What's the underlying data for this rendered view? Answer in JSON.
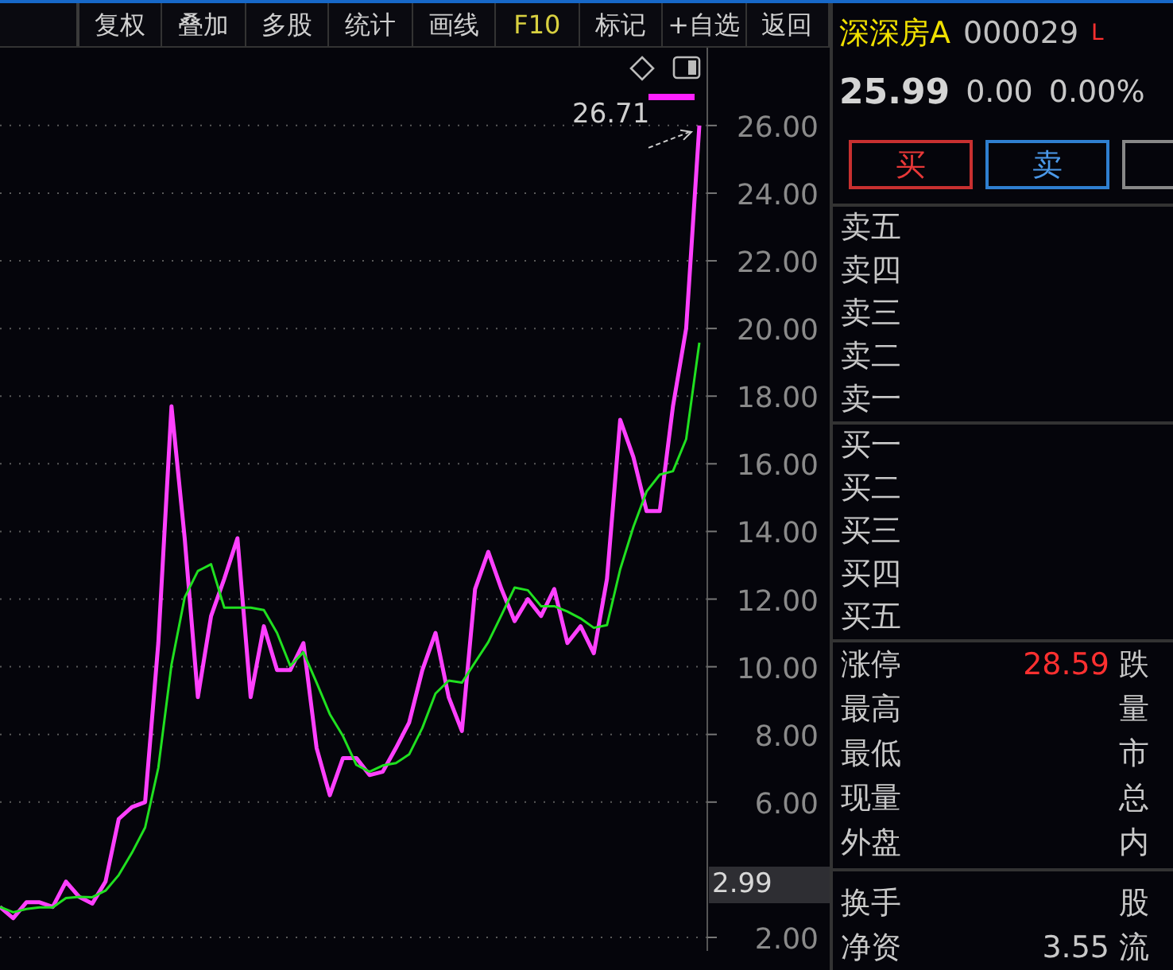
{
  "toolbar": {
    "buttons": [
      {
        "label": "复权",
        "highlight": false
      },
      {
        "label": "叠加",
        "highlight": false
      },
      {
        "label": "多股",
        "highlight": false
      },
      {
        "label": "统计",
        "highlight": false
      },
      {
        "label": "画线",
        "highlight": false
      },
      {
        "label": "F10",
        "highlight": true
      },
      {
        "label": "标记",
        "highlight": false
      },
      {
        "label": "+自选",
        "highlight": false
      },
      {
        "label": "返回",
        "highlight": false
      }
    ]
  },
  "chart": {
    "max_label": "26.71",
    "price_marker": "2.99",
    "chart_data": {
      "type": "line",
      "ylim": [
        1.6,
        28.3
      ],
      "grid": true,
      "yticks": [
        {
          "value": 2,
          "label": "2.00"
        },
        {
          "value": 6,
          "label": "6.00"
        },
        {
          "value": 8,
          "label": "8.00"
        },
        {
          "value": 10,
          "label": "10.00"
        },
        {
          "value": 12,
          "label": "12.00"
        },
        {
          "value": 14,
          "label": "14.00"
        },
        {
          "value": 16,
          "label": "16.00"
        },
        {
          "value": 18,
          "label": "18.00"
        },
        {
          "value": 20,
          "label": "20.00"
        },
        {
          "value": 22,
          "label": "22.00"
        },
        {
          "value": 24,
          "label": "24.00"
        },
        {
          "value": 26,
          "label": "26.00"
        }
      ],
      "series": [
        {
          "color": "#ff40ff",
          "values": [
            2.9,
            2.57,
            3.04,
            3.04,
            2.9,
            3.65,
            3.2,
            3.0,
            3.65,
            5.5,
            5.85,
            6.0,
            10.7,
            17.7,
            13.8,
            9.1,
            11.5,
            12.6,
            13.8,
            9.1,
            11.2,
            9.9,
            9.9,
            10.7,
            7.6,
            6.2,
            7.3,
            7.3,
            6.8,
            6.9,
            7.6,
            8.35,
            9.9,
            11.0,
            9.1,
            8.1,
            12.3,
            13.4,
            12.3,
            11.35,
            12.0,
            11.5,
            12.3,
            10.7,
            11.2,
            10.4,
            12.6,
            17.3,
            16.2,
            14.6,
            14.6,
            17.7,
            20.0,
            26.0
          ]
        },
        {
          "color": "#20e020",
          "values": [
            2.9,
            2.74,
            2.84,
            2.89,
            2.89,
            3.16,
            3.2,
            3.19,
            3.38,
            3.84,
            4.5,
            5.25,
            7.01,
            10.06,
            12.05,
            12.83,
            13.03,
            11.75,
            11.75,
            11.75,
            11.68,
            11.0,
            10.03,
            10.43,
            9.53,
            8.6,
            7.95,
            7.1,
            6.9,
            7.08,
            7.15,
            7.41,
            8.19,
            9.21,
            9.59,
            9.53,
            10.13,
            10.73,
            11.53,
            12.34,
            12.26,
            11.79,
            11.79,
            11.63,
            11.43,
            11.15,
            11.23,
            12.88,
            14.13,
            15.18,
            15.68,
            15.78,
            16.73,
            19.58
          ]
        }
      ]
    }
  },
  "quote": {
    "name": "深深房A",
    "code": "000029",
    "tag": "L",
    "price": "25.99",
    "change": "0.00",
    "change_pct": "0.00%"
  },
  "trade_buttons": [
    {
      "kind": "buy",
      "label": "买"
    },
    {
      "kind": "sell",
      "label": "卖"
    },
    {
      "kind": "partial"
    }
  ],
  "order_book": {
    "asks": [
      "卖五",
      "卖四",
      "卖三",
      "卖二",
      "卖一"
    ],
    "bids": [
      "买一",
      "买二",
      "买三",
      "买四",
      "买五"
    ]
  },
  "stats": [
    {
      "label": "涨停",
      "value": "28.59",
      "color": "#ff3030",
      "label_2": "跌"
    },
    {
      "label": "最高",
      "label_2": "量"
    },
    {
      "label": "最低",
      "label_2": "市"
    },
    {
      "label": "现量",
      "label_2": "总"
    },
    {
      "label": "外盘",
      "label_2": "内"
    }
  ],
  "stats_2": [
    {
      "label": "换手",
      "label_2": "股"
    },
    {
      "label": "净资",
      "value": "3.55",
      "color": "#c8c8c8",
      "label_2": "流"
    }
  ]
}
